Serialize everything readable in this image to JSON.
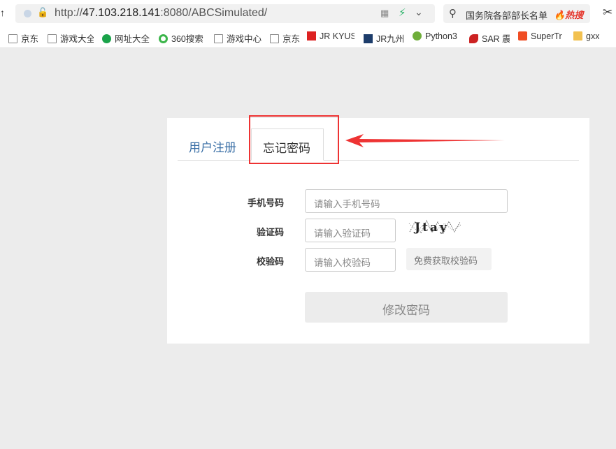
{
  "browser": {
    "url_prefix": "http://",
    "url_host": "47.103.218.141",
    "url_rest": ":8080/ABCSimulated/",
    "search_text": "国务院各部部长名单",
    "hot_label": "热搜"
  },
  "bookmarks": [
    {
      "label": "京东",
      "icon": "page-icon"
    },
    {
      "label": "游戏大全",
      "icon": "page-icon"
    },
    {
      "label": "网址大全",
      "icon": "green-globe-icon"
    },
    {
      "label": "360搜索",
      "icon": "360-icon"
    },
    {
      "label": "游戏中心",
      "icon": "page-icon"
    },
    {
      "label": "京东",
      "icon": "page-icon"
    },
    {
      "label": "JR KYUS",
      "icon": "jr-icon"
    },
    {
      "label": "JR九州",
      "icon": "jr9-icon"
    },
    {
      "label": "Python3",
      "icon": "python-icon"
    },
    {
      "label": "SAR 震",
      "icon": "sar-icon"
    },
    {
      "label": "SuperTr",
      "icon": "c-icon"
    },
    {
      "label": "gxx",
      "icon": "folder-icon"
    }
  ],
  "tabs": {
    "register": "用户注册",
    "forgot": "忘记密码"
  },
  "form": {
    "phone_label": "手机号码",
    "phone_placeholder": "请输入手机号码",
    "captcha_label": "验证码",
    "captcha_placeholder": "请输入验证码",
    "captcha_text": "Jtay",
    "sms_label": "校验码",
    "sms_placeholder": "请输入校验码",
    "sms_button": "免费获取校验码",
    "submit": "修改密码"
  },
  "colors": {
    "accent_link": "#3a6fa6",
    "annotation_red": "#e33333"
  }
}
